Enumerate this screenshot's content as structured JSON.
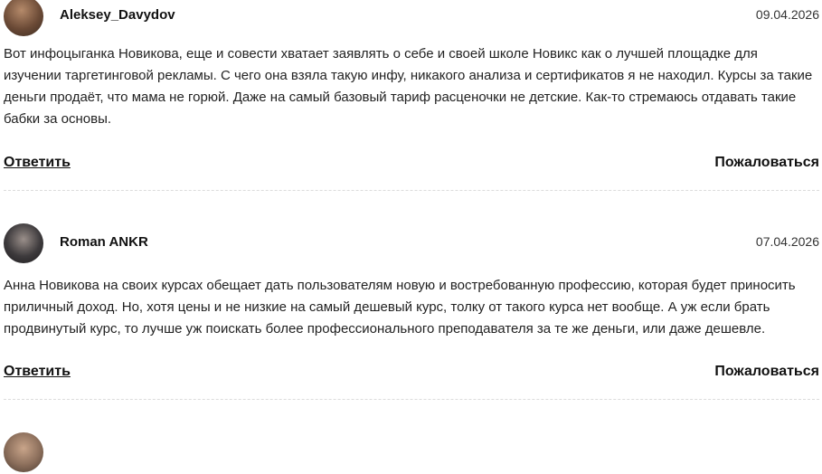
{
  "comments": [
    {
      "author": "Aleksey_Davydov",
      "date": "09.04.2026",
      "text": "Вот инфоцыганка Новикова, еще и совести хватает заявлять о себе и своей школе Новикс как о лучшей площадке для изучении таргетинговой рекламы. С чего она взяла такую инфу, никакого анализа и сертификатов я не находил. Курсы за такие деньги продаёт, что мама не горюй. Даже на самый базовый тариф расценочки не детские. Как-то стремаюсь отдавать такие бабки за основы.",
      "reply_label": "Ответить",
      "report_label": "Пожаловаться"
    },
    {
      "author": "Roman ANKR",
      "date": "07.04.2026",
      "text": "Анна Новикова на своих курсах обещает дать пользователям новую и востребованную профессию, которая будет приносить приличный доход. Но, хотя цены и не низкие на самый дешевый курс, толку от такого курса нет вообще. А уж если брать продвинутый курс, то лучше уж поискать более профессионального преподавателя за те же деньги, или даже дешевле.",
      "reply_label": "Ответить",
      "report_label": "Пожаловаться"
    }
  ],
  "avatar_colors": [
    "#6b4a36",
    "#3d3a3c",
    "#8a6d5a"
  ]
}
